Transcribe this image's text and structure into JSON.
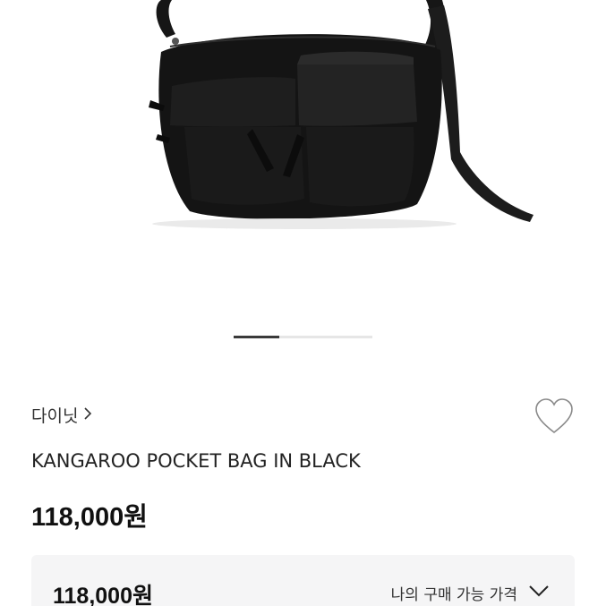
{
  "product": {
    "brand": "다이닛",
    "title": "KANGAROO POCKET BAG IN BLACK",
    "price": "118,000원"
  },
  "carousel": {
    "current_index": 1,
    "total_slides": 3,
    "progress_fraction": 0.33
  },
  "price_box": {
    "price": "118,000원",
    "label": "나의 구매 가능 가격"
  },
  "icons": {
    "brand_chevron": "chevron-right-icon",
    "wish": "heart-outline-icon",
    "expand": "chevron-down-icon"
  },
  "colors": {
    "accent": "#111111",
    "indicator_active": "#3a3a3a",
    "indicator_track": "#e6e6e6",
    "price_box_bg": "#f5f5f6"
  }
}
